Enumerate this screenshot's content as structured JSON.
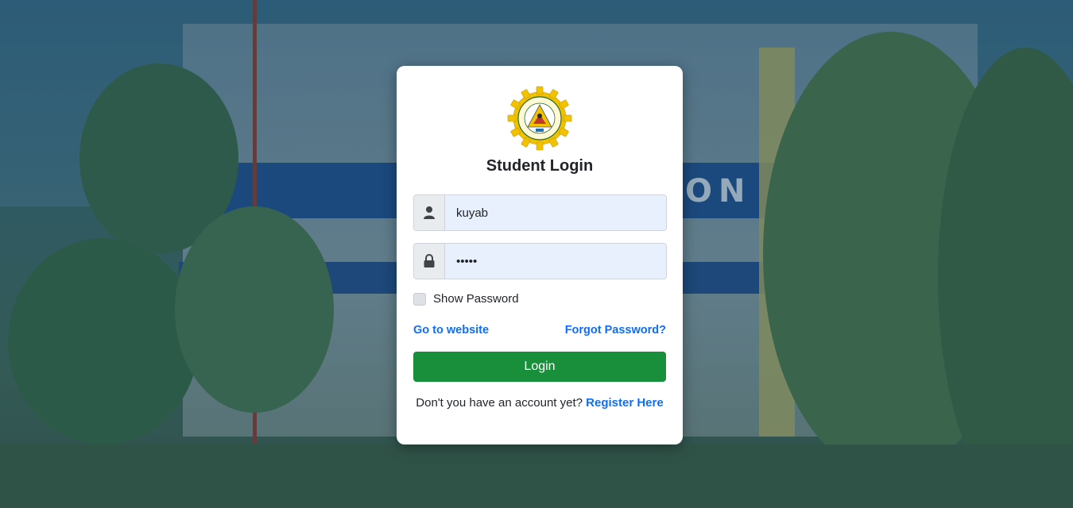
{
  "page": {
    "title": "Student Login"
  },
  "form": {
    "username_value": "kuyab",
    "password_value": "kuyab",
    "show_password_label": "Show Password",
    "go_to_website_label": "Go to website",
    "forgot_password_label": "Forgot Password?",
    "login_button_label": "Login",
    "register_prompt": "Don't you have an account yet?",
    "register_link_label": "Register Here"
  },
  "icons": {
    "username": "user-icon",
    "password": "lock-icon",
    "logo": "school-seal-logo"
  },
  "colors": {
    "primary_link": "#0d6efd",
    "login_button": "#198f3b",
    "logo_gold": "#f2c200",
    "logo_red": "#c0392b"
  }
}
